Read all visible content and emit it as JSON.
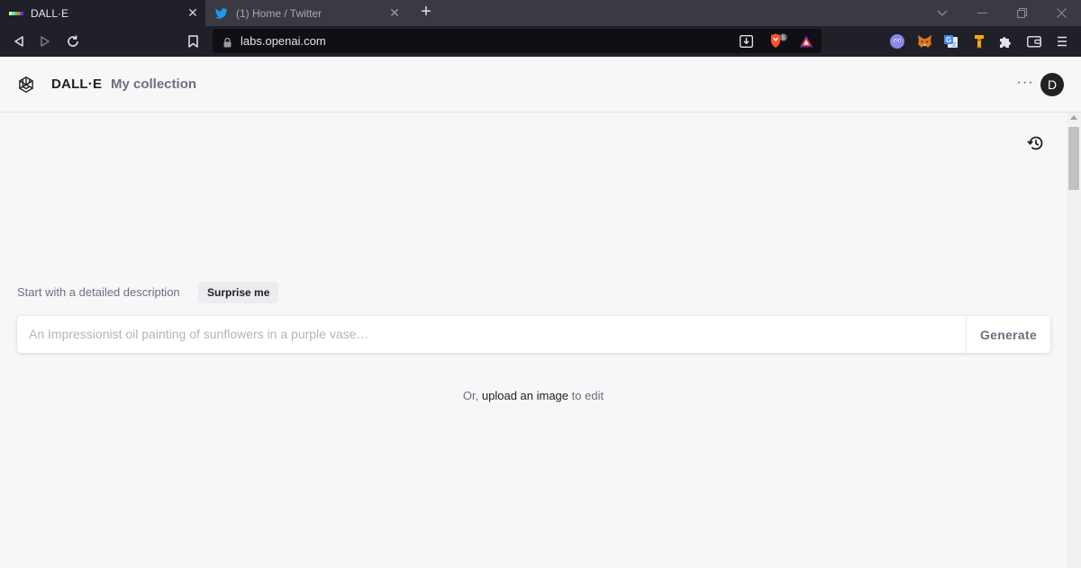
{
  "browser": {
    "tabs": [
      {
        "title": "DALL·E",
        "active": true
      },
      {
        "title": "(1) Home / Twitter",
        "active": false
      }
    ],
    "url": "labs.openai.com",
    "brave_shield_count": "5",
    "colors": {
      "tabbar": "#3a3a42",
      "toolbar": "#202128",
      "urlbar": "#0f0f14",
      "twitter": "#1d9bf0",
      "brave": "#fb542b"
    }
  },
  "header": {
    "brand": "DALL·E",
    "nav_collection": "My collection",
    "more_label": "···",
    "avatar_initial": "D"
  },
  "main": {
    "prompt_label": "Start with a detailed description",
    "surprise_button": "Surprise me",
    "prompt_placeholder": "An Impressionist oil painting of sunflowers in a purple vase…",
    "generate_button": "Generate",
    "upload_prefix": "Or,",
    "upload_link": "upload an image",
    "upload_suffix": "to edit"
  },
  "icons": [
    "back-icon",
    "forward-icon",
    "reload-icon",
    "bookmark-icon",
    "lock-icon",
    "install-icon",
    "brave-shield-icon",
    "brave-rewards-icon",
    "extension-icons",
    "puzzle-icon",
    "wallet-icon",
    "menu-icon",
    "openai-logo",
    "history-icon"
  ]
}
